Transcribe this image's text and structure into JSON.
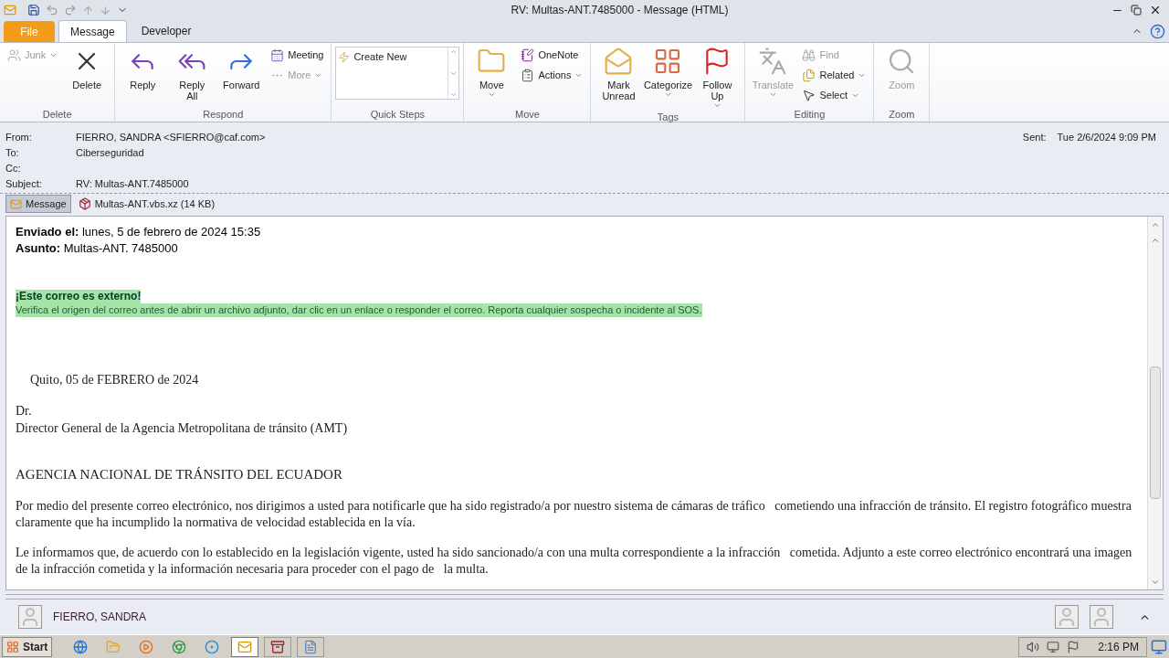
{
  "window": {
    "title": "RV: Multas-ANT.7485000  -  Message (HTML)"
  },
  "tabs": [
    {
      "label": "File",
      "kind": "file",
      "selected": false
    },
    {
      "label": "Message",
      "kind": "tab",
      "selected": true
    },
    {
      "label": "Developer",
      "kind": "tab",
      "selected": false
    }
  ],
  "ribbon": [
    {
      "name": "Delete",
      "items": [
        {
          "kind": "small-col",
          "entries": [
            {
              "label": "Junk",
              "disabled": true,
              "dropdown": true
            }
          ]
        },
        {
          "kind": "large",
          "label": "Delete",
          "disabled": false,
          "dropdown": false
        }
      ]
    },
    {
      "name": "Respond",
      "items": [
        {
          "kind": "large",
          "label": "Reply",
          "disabled": false,
          "dropdown": false
        },
        {
          "kind": "large",
          "label": "Reply All",
          "disabled": false,
          "dropdown": false
        },
        {
          "kind": "large",
          "label": "Forward",
          "disabled": false,
          "dropdown": false
        },
        {
          "kind": "small-col",
          "entries": [
            {
              "label": "Meeting",
              "disabled": false,
              "dropdown": false
            },
            {
              "label": "More",
              "disabled": true,
              "dropdown": true
            }
          ]
        }
      ]
    },
    {
      "name": "Quick Steps",
      "items": [
        {
          "kind": "gallery",
          "entries": [
            {
              "label": "Create New",
              "disabled": false
            }
          ]
        }
      ]
    },
    {
      "name": "Move",
      "items": [
        {
          "kind": "large",
          "label": "Move",
          "disabled": false,
          "dropdown": true
        },
        {
          "kind": "small-col",
          "entries": [
            {
              "label": "OneNote",
              "disabled": false,
              "dropdown": false
            },
            {
              "label": "Actions",
              "disabled": false,
              "dropdown": true
            }
          ]
        }
      ]
    },
    {
      "name": "Tags",
      "items": [
        {
          "kind": "large",
          "label": "Mark Unread",
          "disabled": false,
          "dropdown": false
        },
        {
          "kind": "large",
          "label": "Categorize",
          "disabled": false,
          "dropdown": true
        },
        {
          "kind": "large",
          "label": "Follow Up",
          "disabled": false,
          "dropdown": true
        }
      ]
    },
    {
      "name": "Editing",
      "items": [
        {
          "kind": "large",
          "label": "Translate",
          "disabled": true,
          "dropdown": true
        },
        {
          "kind": "small-col",
          "entries": [
            {
              "label": "Find",
              "disabled": true,
              "dropdown": false
            },
            {
              "label": "Related",
              "disabled": false,
              "dropdown": true
            },
            {
              "label": "Select",
              "disabled": false,
              "dropdown": true
            }
          ]
        }
      ]
    },
    {
      "name": "Zoom",
      "items": [
        {
          "kind": "large",
          "label": "Zoom",
          "disabled": true,
          "dropdown": false
        }
      ]
    }
  ],
  "header": {
    "fields": [
      {
        "label": "From:",
        "value": "FIERRO, SANDRA <SFIERRO@caf.com>"
      },
      {
        "label": "To:",
        "value": "Ciberseguridad"
      },
      {
        "label": "Cc:"
      },
      {
        "label": "Subject:",
        "value": "RV: Multas-ANT.7485000"
      }
    ],
    "sent": {
      "label": "Sent:",
      "value": "Tue 2/6/2024 9:09 PM"
    }
  },
  "attachments": [
    {
      "label": "Message",
      "kind": "message",
      "selected": true
    },
    {
      "label": "Multas-ANT.vbs.xz (14 KB)",
      "kind": "archive",
      "selected": false
    }
  ],
  "body": [
    {
      "kind": "meta",
      "text": "**Enviado el:** lunes, 5 de febrero de 2024 15:35"
    },
    {
      "kind": "meta",
      "text": "**Asunto:** Multas-ANT. 7485000"
    },
    {
      "kind": "banner",
      "title": "¡Este correo es externo!",
      "text": "Verifica el origen del correo antes de abrir un archivo adjunto, dar clic en un enlace o responder el correo. Reporta cualquier sospecha o incidente al SOS."
    },
    {
      "kind": "date",
      "text": "Quito, 05 de FEBRERO de 2024"
    },
    {
      "kind": "line",
      "text": "Dr."
    },
    {
      "kind": "line",
      "text": "Director General de la Agencia Metropolitana de tránsito (AMT)"
    },
    {
      "kind": "heading",
      "text": "AGENCIA NACIONAL DE TRÁNSITO DEL ECUADOR"
    },
    {
      "kind": "para",
      "text": "Por medio del presente correo electrónico, nos dirigimos a usted para notificarle que ha sido registrado/a por nuestro sistema de cámaras de tráfico   cometiendo una infracción de tránsito. El registro fotográfico muestra claramente que ha incumplido la normativa de velocidad establecida en la vía."
    },
    {
      "kind": "para",
      "text": "Le informamos que, de acuerdo con lo establecido en la legislación vigente, usted ha sido sancionado/a con una multa correspondiente a la infracción   cometida. Adjunto a este correo electrónico encontrará una imagen de la infracción cometida y la información necesaria para proceder con el pago de   la multa."
    }
  ],
  "people": {
    "name": "FIERRO, SANDRA"
  },
  "taskbar": {
    "start": "Start",
    "clock": "2:16 PM",
    "apps": [
      {
        "selected": false
      },
      {
        "selected": false
      },
      {
        "selected": false
      },
      {
        "selected": false
      },
      {
        "selected": false
      },
      {
        "selected": true
      },
      {
        "selected": false
      },
      {
        "selected": false
      }
    ]
  }
}
